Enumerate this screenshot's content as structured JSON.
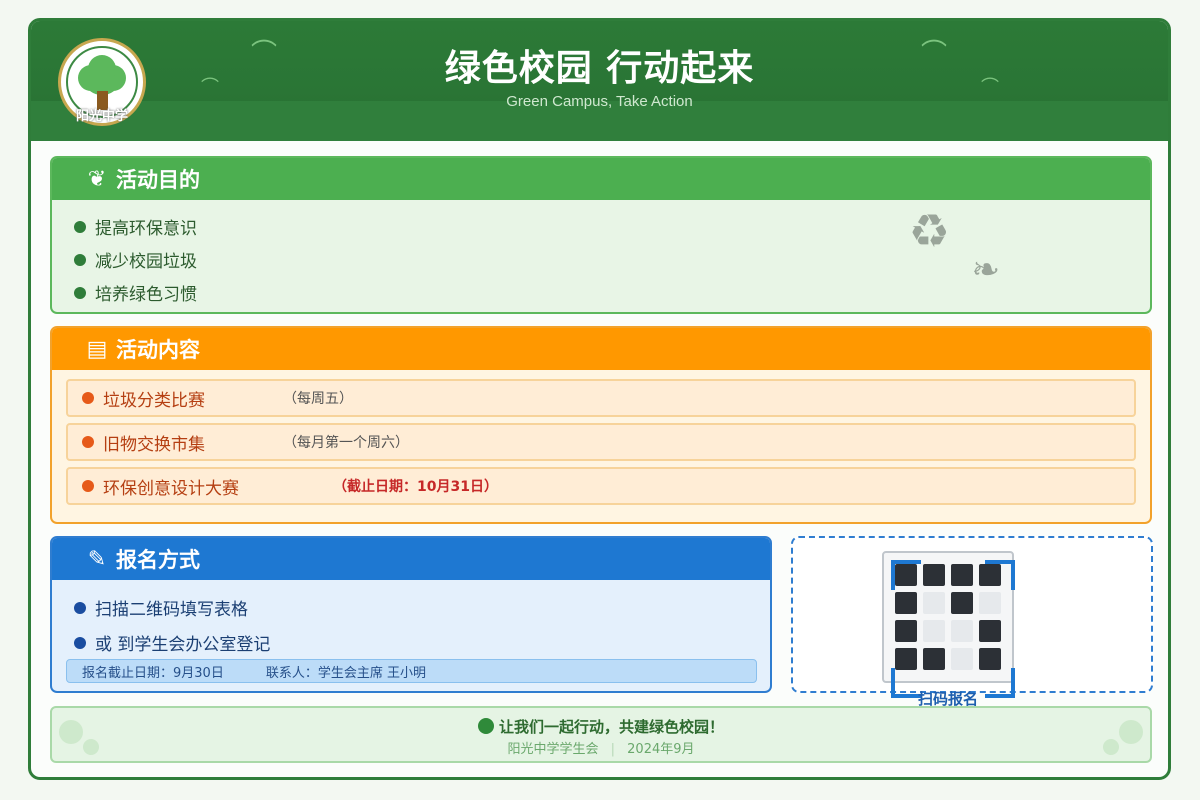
{
  "header": {
    "title": "绿色校园 行动起来",
    "subtitle": "Green Campus, Take Action",
    "logo_text": "阳光中学"
  },
  "goals": {
    "icon": "leaf-icon",
    "title": "活动目的",
    "items": [
      "提高环保意识",
      "减少校园垃圾",
      "培养绿色习惯"
    ]
  },
  "activities": {
    "icon": "clipboard-icon",
    "title": "活动内容",
    "items": [
      {
        "name": "垃圾分类比赛",
        "note": "（每周五）"
      },
      {
        "name": "旧物交换市集",
        "note": "（每月第一个周六）"
      },
      {
        "name": "环保创意设计大赛",
        "note": "（截止日期：10月31日）"
      }
    ]
  },
  "signup": {
    "icon": "memo-icon",
    "title": "报名方式",
    "items": [
      "扫描二维码填写表格",
      "或 到学生会办公室登记"
    ],
    "deadline": "报名截止日期：9月30日",
    "contact": "联系人：学生会主席 王小明"
  },
  "qr": {
    "label": "扫码报名"
  },
  "footer": {
    "slogan": "让我们一起行动，共建绿色校园！",
    "organizer": "阳光中学学生会",
    "separator": "|",
    "date": "2024年9月"
  },
  "colors": {
    "header_green": "#2c7a37",
    "goals_green": "#4caf50",
    "activities_orange": "#ff9800",
    "signup_blue": "#1e78d2",
    "deadline_red": "#c62828"
  }
}
